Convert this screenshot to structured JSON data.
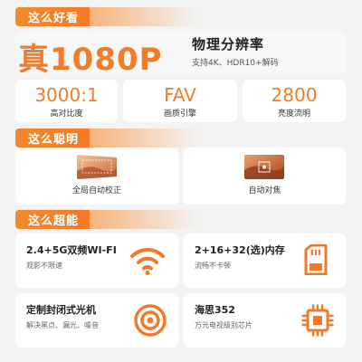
{
  "sections": {
    "look": {
      "title": "这么好看"
    },
    "smart": {
      "title": "这么聪明"
    },
    "powerful": {
      "title": "这么超能"
    }
  },
  "hero": {
    "resolution": "真1080P",
    "title": "物理分辨率",
    "subtitle": "支持4K、HDR10+解码"
  },
  "stats": [
    {
      "value": "3000:1",
      "label": "高对比度"
    },
    {
      "value": "FAV",
      "label": "画质引擎"
    },
    {
      "value": "2800",
      "label": "亮度流明"
    }
  ],
  "features": [
    {
      "label": "全局自动校正",
      "icon": "keystone-correction-thumbnail"
    },
    {
      "label": "自动对焦",
      "icon": "autofocus-thumbnail"
    }
  ],
  "specs": [
    {
      "title": "2.4+5G双频WI-FI",
      "subtitle": "观影不限速",
      "icon": "wifi-icon"
    },
    {
      "title": "2+16+32(选)内存",
      "subtitle": "流畅不卡顿",
      "icon": "sd-card-icon"
    },
    {
      "title": "定制封闭式光机",
      "subtitle": "解决黑点、漏光、噪音",
      "icon": "lens-icon"
    },
    {
      "title": "海思352",
      "subtitle": "万元电视级别芯片",
      "icon": "chip-icon"
    }
  ],
  "colors": {
    "accent": "#ef7d2c",
    "background": "#f3f3f3",
    "card": "#ffffff"
  }
}
